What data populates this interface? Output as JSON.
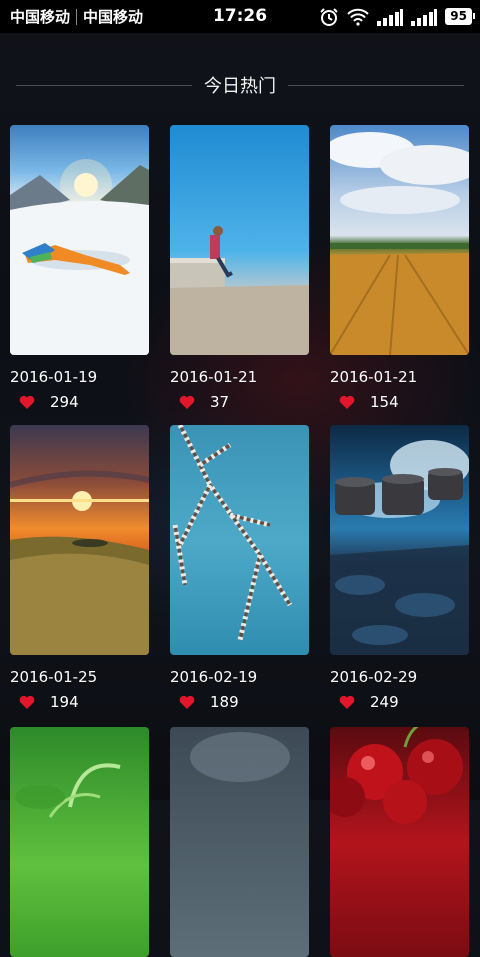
{
  "status_bar": {
    "carrier_1": "中国移动",
    "carrier_2": "中国移动",
    "time": "17:26",
    "battery": "95",
    "icons": [
      "alarm-icon",
      "wifi-icon",
      "signal-icon",
      "signal-icon",
      "battery-icon"
    ]
  },
  "section": {
    "title": "今日热门"
  },
  "items": [
    {
      "date": "2016-01-19",
      "likes": "294",
      "image": "snow angel on snowy slope under blue sky"
    },
    {
      "date": "2016-01-21",
      "likes": "37",
      "image": "person sitting on wall above sand under blue sky"
    },
    {
      "date": "2016-01-21",
      "likes": "154",
      "image": "golden wheat field under clouds"
    },
    {
      "date": "2016-01-25",
      "likes": "194",
      "image": "sunset over grassy hill"
    },
    {
      "date": "2016-02-19",
      "likes": "189",
      "image": "frosted branch against blue sky"
    },
    {
      "date": "2016-02-29",
      "likes": "249",
      "image": "waves splashing over stone posts"
    },
    {
      "date": "",
      "likes": "",
      "image": "green plant close-up"
    },
    {
      "date": "",
      "likes": "",
      "image": "grey blurred texture"
    },
    {
      "date": "",
      "likes": "",
      "image": "red cherries"
    }
  ],
  "colors": {
    "heart": "#e3172b",
    "background": "#0e1117"
  }
}
